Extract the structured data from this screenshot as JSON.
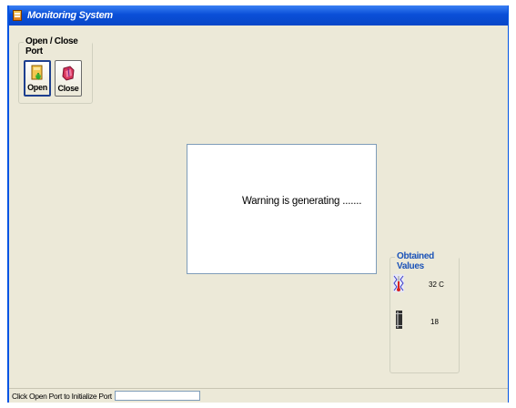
{
  "window": {
    "title": "Monitoring System"
  },
  "port_group": {
    "title": "Open / Close Port",
    "open_label": "Open",
    "close_label": "Close"
  },
  "message": {
    "text": "Warning is generating ......."
  },
  "values_group": {
    "title": "Obtained Values",
    "temperature": "32 C",
    "level": "18"
  },
  "statusbar": {
    "text": "Click Open Port to Initialize Port",
    "input_value": ""
  },
  "colors": {
    "titlebar": "#0a4fd8",
    "group_title_blue": "#1a52b8",
    "window_bg": "#ece9d8"
  }
}
